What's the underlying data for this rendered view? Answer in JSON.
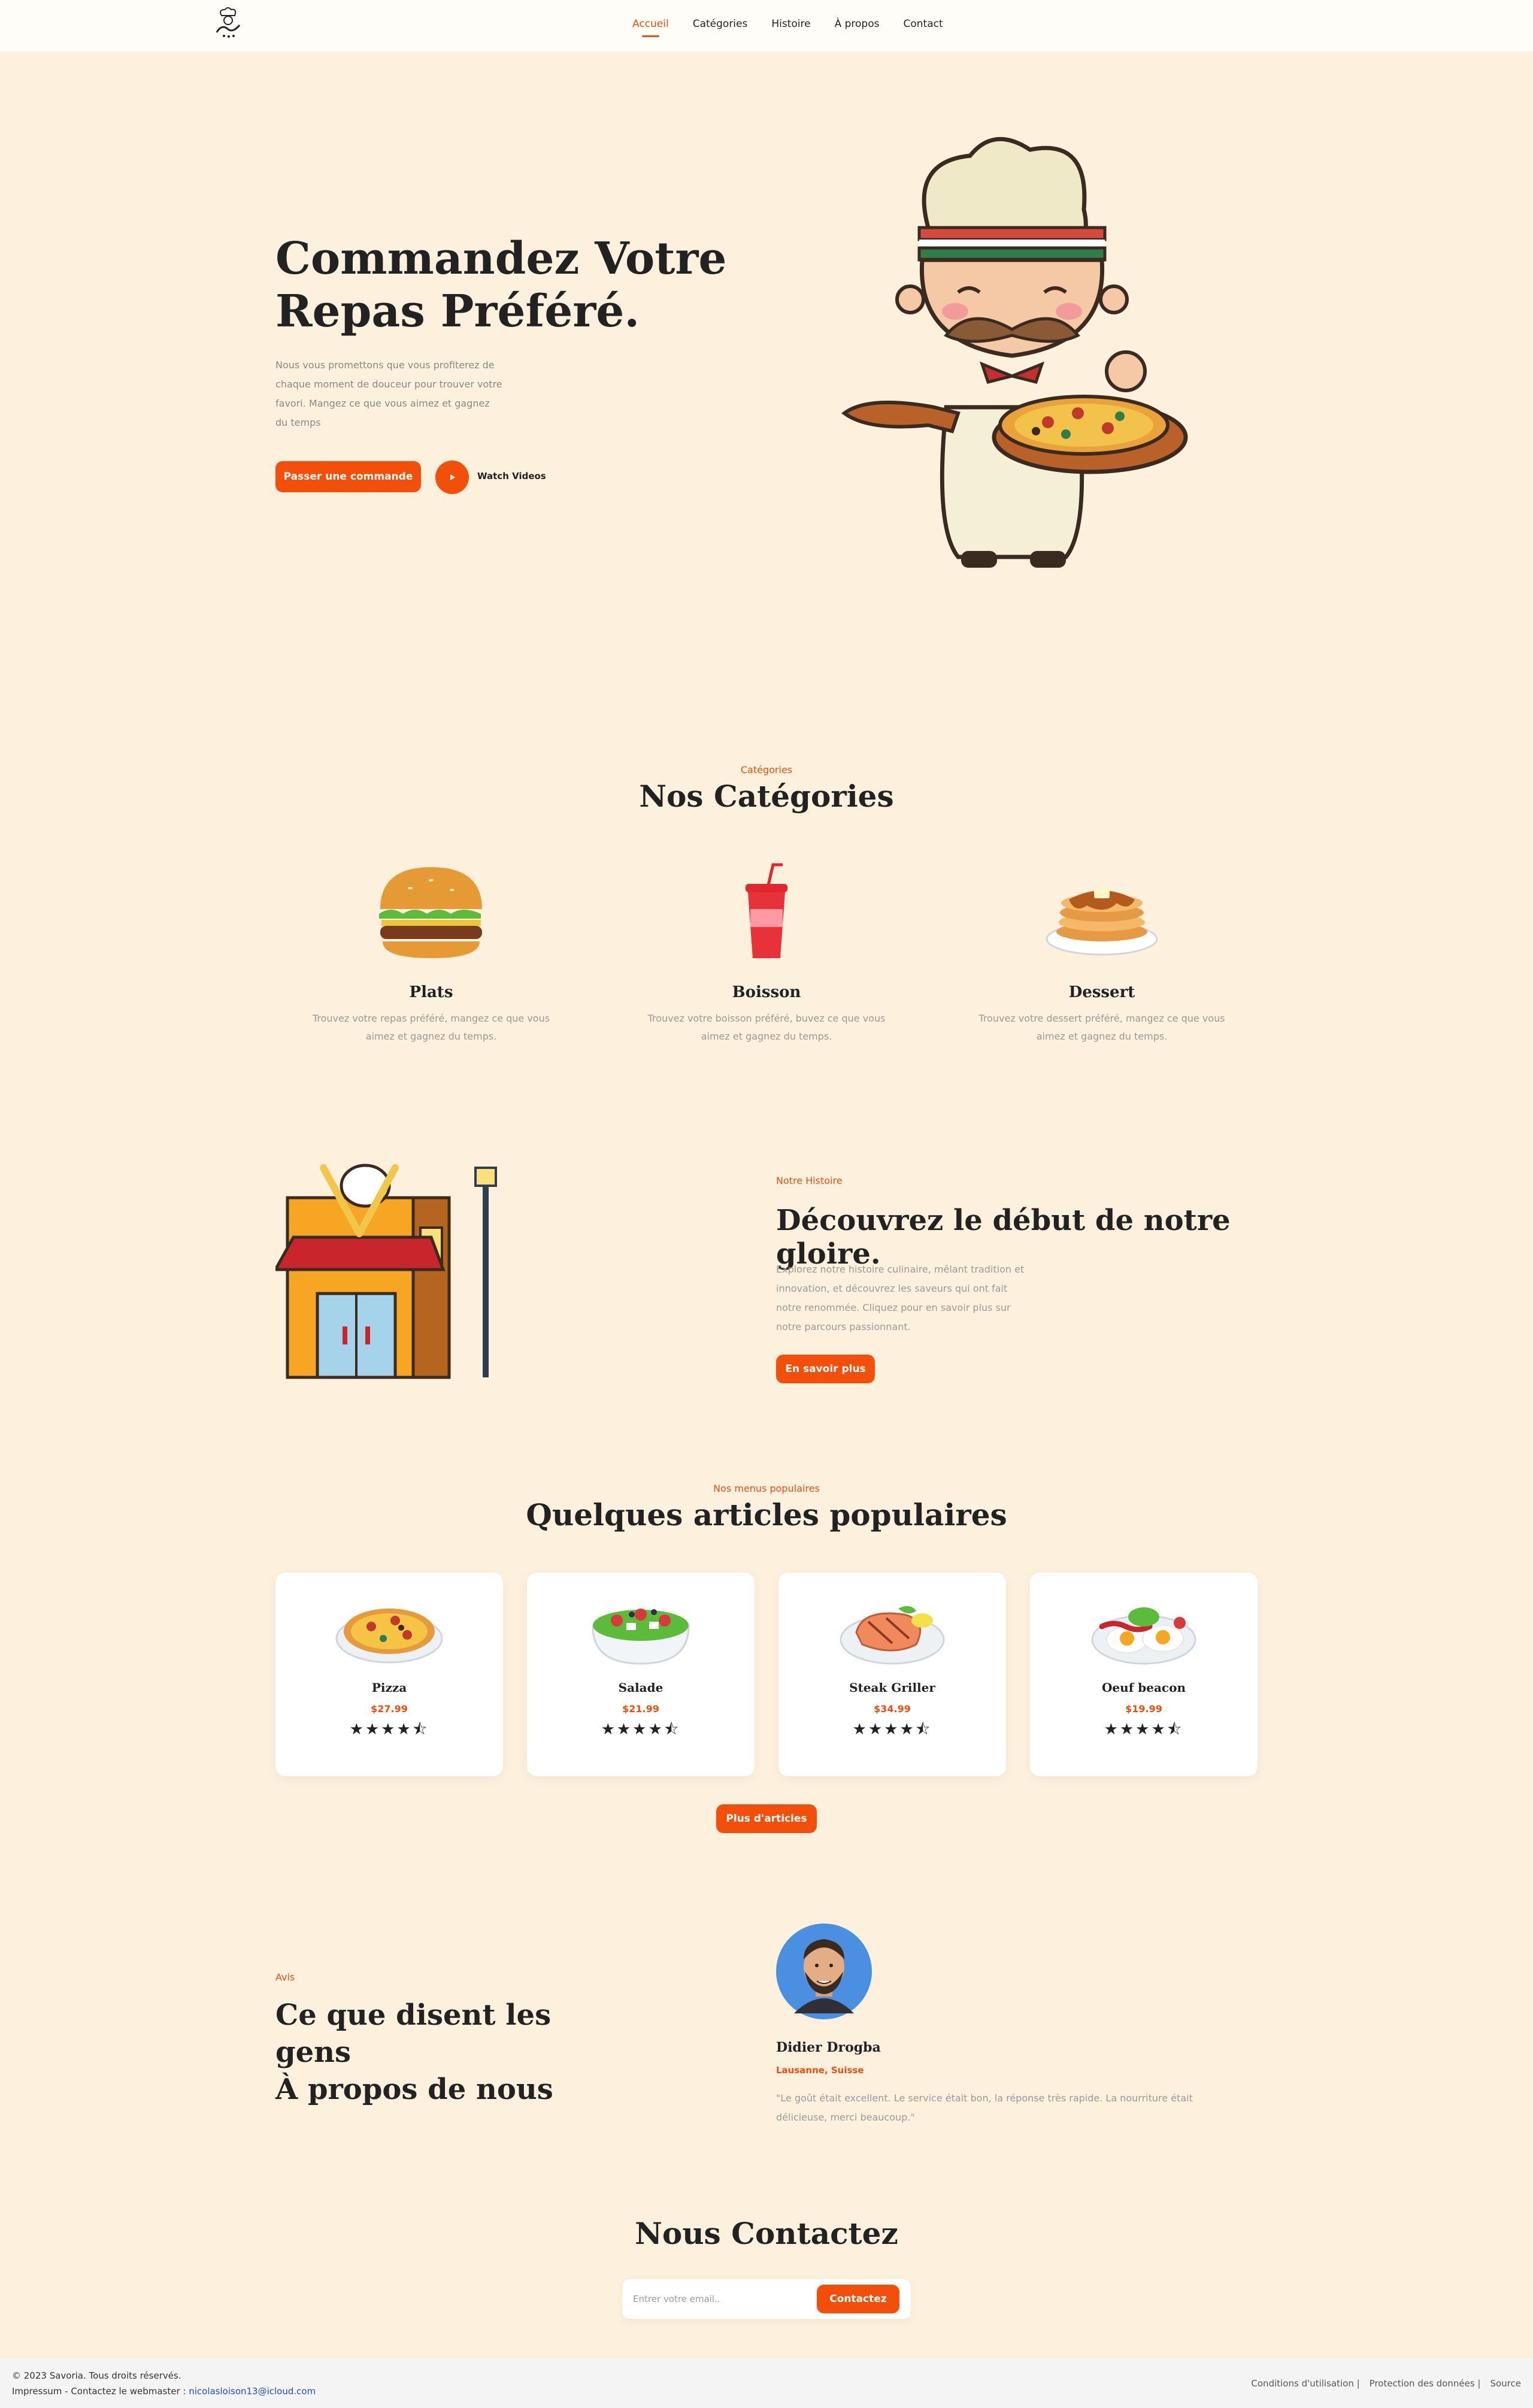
{
  "nav": {
    "items": [
      "Accueil",
      "Catégories",
      "Histoire",
      "À propos",
      "Contact"
    ]
  },
  "logo": {
    "icon": "chef-logo-icon"
  },
  "hero": {
    "title_line1": "Commandez Votre",
    "title_line2": "Repas Préféré.",
    "description": "Nous vous promettons que vous profiterez de chaque moment de douceur pour trouver votre favori. Mangez ce que vous aimez et gagnez du temps",
    "order_button": "Passer une commande",
    "watch_label": "Watch Videos"
  },
  "categories": {
    "kicker": "Catégories",
    "title": "Nos Catégories",
    "items": [
      {
        "name": "Plats",
        "icon": "burger-icon",
        "desc": "Trouvez votre repas préféré, mangez ce que vous aimez et gagnez du temps."
      },
      {
        "name": "Boisson",
        "icon": "drink-icon",
        "desc": "Trouvez votre boisson préféré, buvez ce que vous aimez et gagnez du temps."
      },
      {
        "name": "Dessert",
        "icon": "pancake-icon",
        "desc": "Trouvez votre dessert préféré, mangez ce que vous aimez et gagnez du temps."
      }
    ]
  },
  "history": {
    "kicker": "Notre Histoire",
    "title": "Découvrez le début de notre gloire.",
    "description": "Explorez notre histoire culinaire, mêlant tradition et innovation, et découvrez les saveurs qui ont fait notre renommée. Cliquez pour en savoir plus sur notre parcours passionnant.",
    "button": "En savoir plus"
  },
  "popular": {
    "kicker": "Nos menus populaires",
    "title": "Quelques articles populaires",
    "items": [
      {
        "name": "Pizza",
        "price": "$27.99",
        "rating": 4.5,
        "stars": "★★★★⯪"
      },
      {
        "name": "Salade",
        "price": "$21.99",
        "rating": 4.5,
        "stars": "★★★★⯪"
      },
      {
        "name": "Steak Griller",
        "price": "$34.99",
        "rating": 4.5,
        "stars": "★★★★⯪"
      },
      {
        "name": "Oeuf beacon",
        "price": "$19.99",
        "rating": 4.5,
        "stars": "★★★★⯪"
      }
    ],
    "more_button": "Plus d'articles"
  },
  "reviews": {
    "kicker": "Avis",
    "title_line1": "Ce que disent les gens",
    "title_line2": "À propos de nous",
    "name": "Didier Drogba",
    "location": "Lausanne, Suisse",
    "quote": "\"Le goût était excellent. Le service était bon, la réponse très rapide. La nourriture était délicieuse, merci beaucoup.\""
  },
  "contact": {
    "title": "Nous Contactez",
    "placeholder": "Entrer votre email..",
    "button": "Contactez"
  },
  "footer": {
    "copyright": "© 2023 Savoria. Tous droits réservés.",
    "line2_prefix": "Impressum - Contactez le webmaster : ",
    "email": "nicolasloison13@icloud.com",
    "links": [
      "Conditions d'utilisation |",
      "Protection des données |",
      "Source"
    ]
  },
  "colors": {
    "accent": "#f24f0b",
    "background": "#fdf0dc"
  }
}
